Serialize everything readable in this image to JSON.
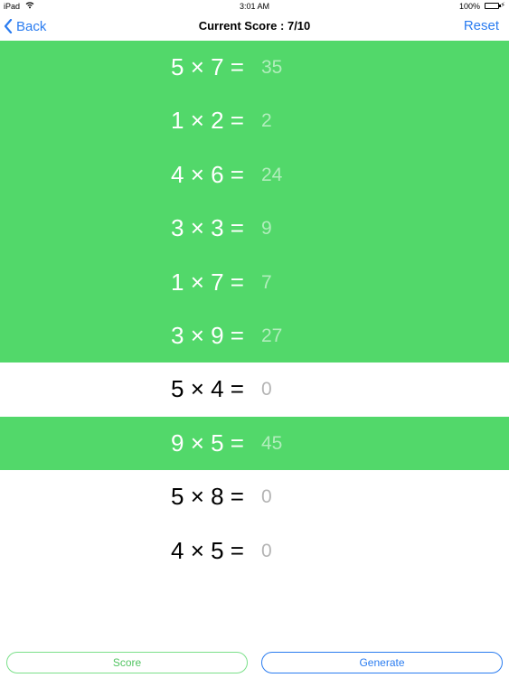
{
  "status": {
    "device": "iPad",
    "time": "3:01 AM",
    "battery": "100%",
    "battery_level": 1.0
  },
  "nav": {
    "back_label": "Back",
    "title": "Current Score : 7/10",
    "reset_label": "Reset"
  },
  "rows": [
    {
      "equation": "5 × 7 =",
      "answer": "35",
      "correct": true
    },
    {
      "equation": "1 × 2 =",
      "answer": "2",
      "correct": true
    },
    {
      "equation": "4 × 6 =",
      "answer": "24",
      "correct": true
    },
    {
      "equation": "3 × 3 =",
      "answer": "9",
      "correct": true
    },
    {
      "equation": "1 × 7 =",
      "answer": "7",
      "correct": true
    },
    {
      "equation": "3 × 9 =",
      "answer": "27",
      "correct": true
    },
    {
      "equation": "5 × 4 =",
      "answer": "0",
      "correct": false
    },
    {
      "equation": "9 × 5 =",
      "answer": "45",
      "correct": true
    },
    {
      "equation": "5 × 8 =",
      "answer": "0",
      "correct": false
    },
    {
      "equation": "4 × 5 =",
      "answer": "0",
      "correct": false
    }
  ],
  "buttons": {
    "score_label": "Score",
    "generate_label": "Generate"
  },
  "colors": {
    "correct_row": "#52d86a",
    "accent": "#2a7cf0"
  }
}
